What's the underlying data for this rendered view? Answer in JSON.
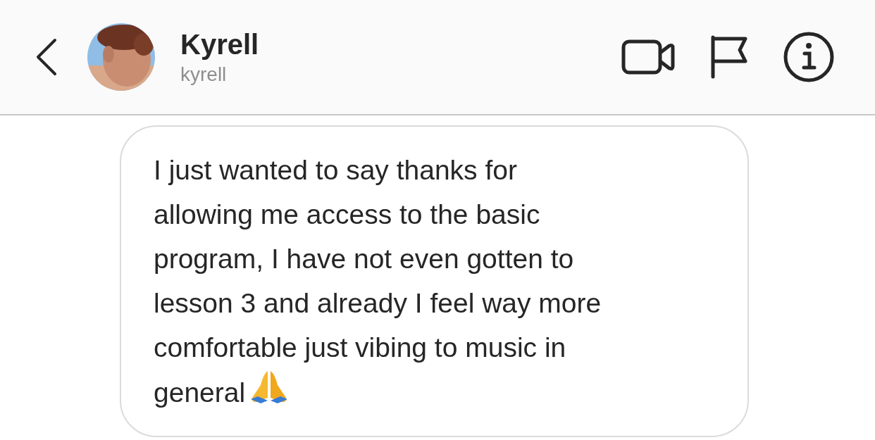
{
  "header": {
    "name": "Kyrell",
    "username": "kyrell"
  },
  "message": {
    "text": "I just wanted to say thanks for\nallowing me access to the basic\nprogram, I have not even gotten to\nlesson 3 and already I feel way more\ncomfortable just vibing to music in\ngeneral"
  }
}
